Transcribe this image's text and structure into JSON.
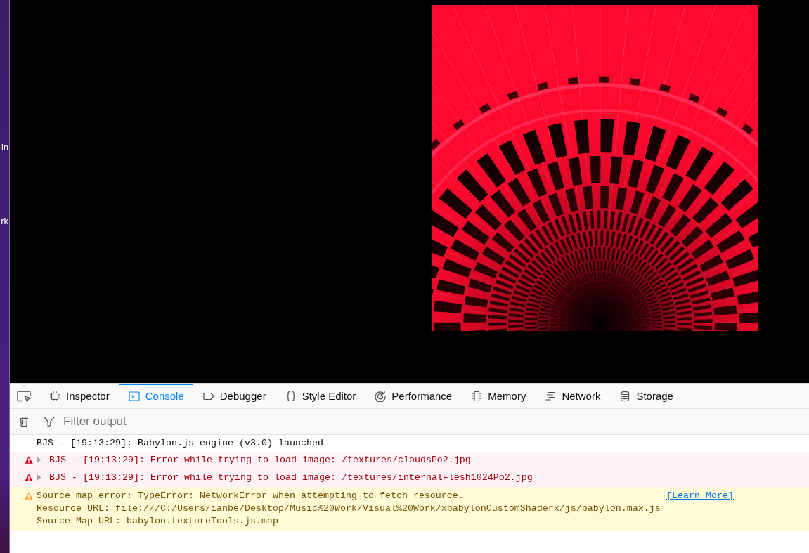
{
  "desktop": {
    "icon_labels": [
      "in",
      "rk"
    ]
  },
  "devtools": {
    "tabs": [
      {
        "label": "Inspector",
        "selected": false
      },
      {
        "label": "Console",
        "selected": true
      },
      {
        "label": "Debugger",
        "selected": false
      },
      {
        "label": "Style Editor",
        "selected": false
      },
      {
        "label": "Performance",
        "selected": false
      },
      {
        "label": "Memory",
        "selected": false
      },
      {
        "label": "Network",
        "selected": false
      },
      {
        "label": "Storage",
        "selected": false
      }
    ],
    "filter": {
      "placeholder": "Filter output"
    },
    "messages": [
      {
        "kind": "log",
        "lines": [
          "BJS - [19:13:29]: Babylon.js engine (v3.0) launched"
        ]
      },
      {
        "kind": "error",
        "expanded": false,
        "lines": [
          "BJS - [19:13:29]: Error while trying to load image: /textures/cloudsPo2.jpg"
        ]
      },
      {
        "kind": "error",
        "expanded": false,
        "lines": [
          "BJS - [19:13:29]: Error while trying to load image: /textures/internalFlesh1024Po2.jpg"
        ]
      },
      {
        "kind": "warning",
        "lines": [
          "Source map error: TypeError: NetworkError when attempting to fetch resource.",
          "Resource URL: file:///C:/Users/ianbe/Desktop/Music%20Work/Visual%20Work/xbabylonCustomShaderx/js/babylon.max.js",
          "Source Map URL: babylon.textureTools.js.map"
        ],
        "link": "[Learn More]"
      }
    ]
  }
}
